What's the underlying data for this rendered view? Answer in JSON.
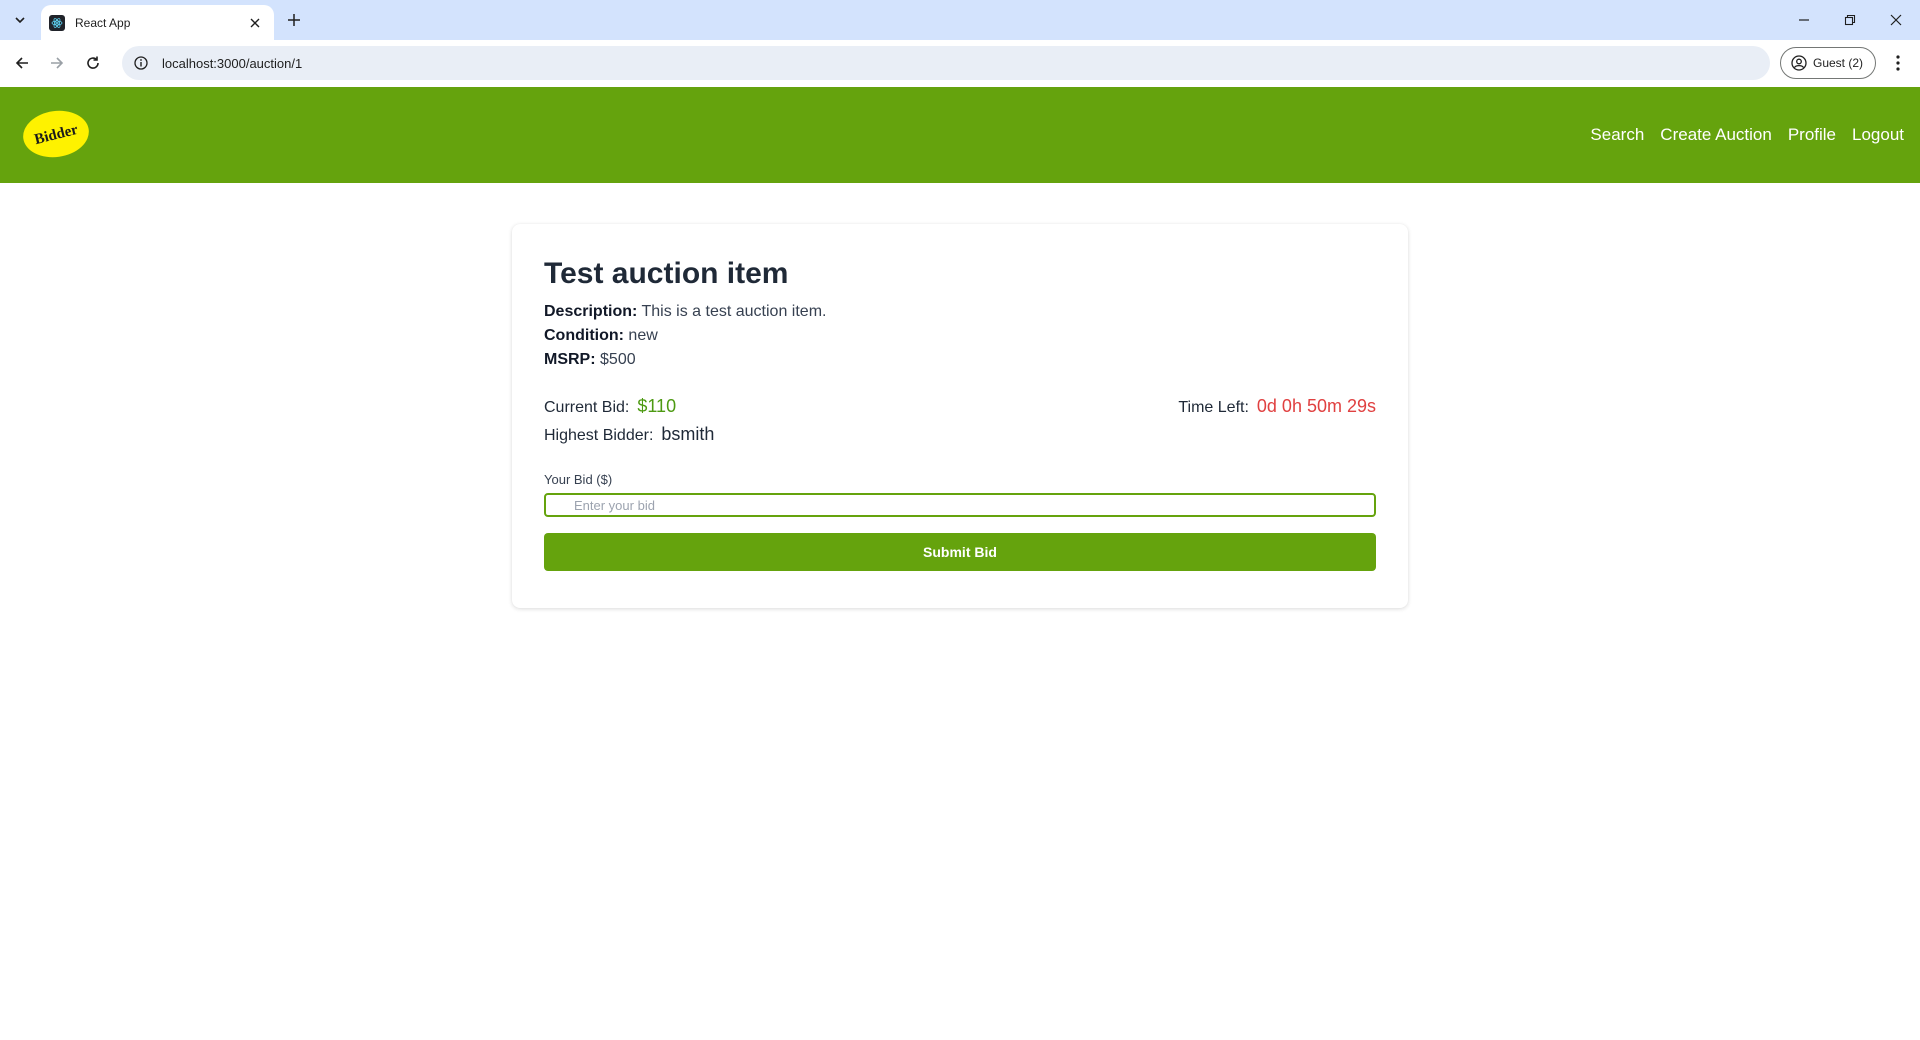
{
  "browser": {
    "tab_title": "React App",
    "url": "localhost:3000/auction/1",
    "profile_label": "Guest (2)"
  },
  "header": {
    "logo_text": "Bidder",
    "nav": [
      "Search",
      "Create Auction",
      "Profile",
      "Logout"
    ]
  },
  "auction": {
    "title": "Test auction item",
    "description_label": "Description:",
    "description": "This is a test auction item.",
    "condition_label": "Condition:",
    "condition": "new",
    "msrp_label": "MSRP:",
    "msrp": "$500",
    "current_bid_label": "Current Bid:",
    "current_bid": "$110",
    "highest_bidder_label": "Highest Bidder:",
    "highest_bidder": "bsmith",
    "time_left_label": "Time Left:",
    "time_left": "0d 0h 50m 29s"
  },
  "bid_form": {
    "label": "Your Bid ($)",
    "placeholder": "Enter your bid",
    "value": "",
    "submit_label": "Submit Bid"
  },
  "colors": {
    "brand_green": "#65a30d",
    "logo_yellow": "#fef200",
    "bid_green": "#4d9a12",
    "time_red": "#e04040"
  }
}
